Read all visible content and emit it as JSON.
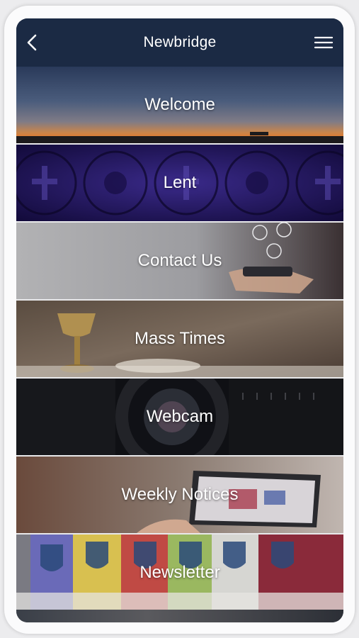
{
  "header": {
    "title": "Newbridge",
    "back_icon": "chevron-left-icon",
    "menu_icon": "hamburger-menu-icon"
  },
  "tiles": [
    {
      "label": "Welcome"
    },
    {
      "label": "Lent"
    },
    {
      "label": "Contact Us"
    },
    {
      "label": "Mass Times"
    },
    {
      "label": "Webcam"
    },
    {
      "label": "Weekly Notices"
    },
    {
      "label": "Newsletter"
    }
  ],
  "colors": {
    "header_bg": "#1b2a44",
    "tile_text": "#ffffff",
    "divider": "#e8e8ea"
  }
}
